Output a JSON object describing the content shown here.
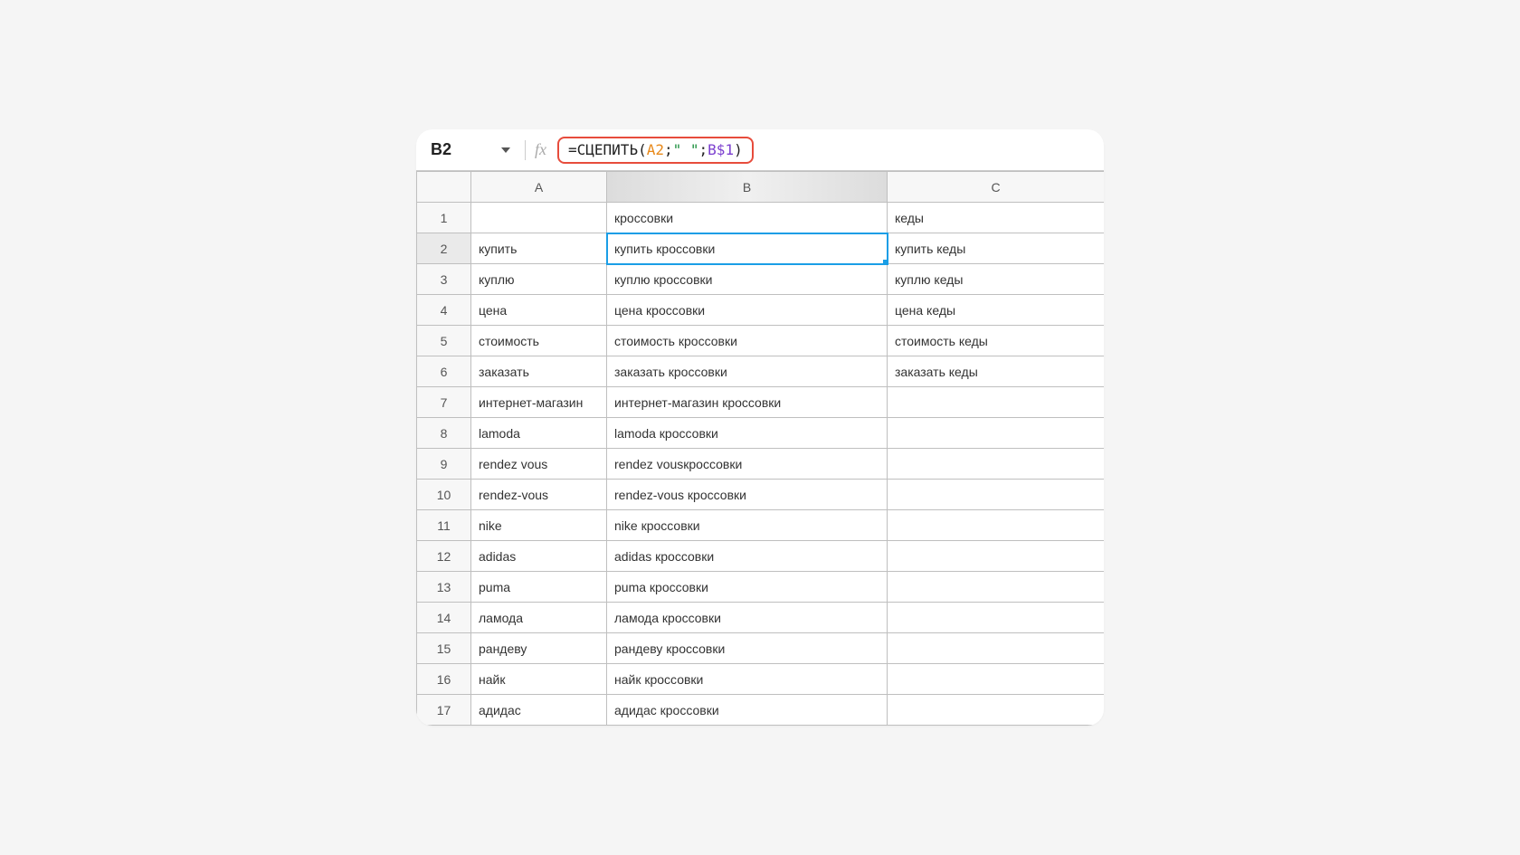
{
  "nameBox": "B2",
  "fx": "fx",
  "formula": {
    "eq": "=",
    "fn": "СЦЕПИТЬ",
    "open": "(",
    "ref1": "A2",
    "sep1": ";",
    "str": "\"  \"",
    "sep2": ";",
    "ref2": "B$1",
    "close": ")"
  },
  "columns": [
    "A",
    "B",
    "C"
  ],
  "rows": [
    {
      "n": "1",
      "A": "",
      "B": "кроссовки",
      "C": "кеды"
    },
    {
      "n": "2",
      "A": "купить",
      "B": "купить кроссовки",
      "C": "купить кеды"
    },
    {
      "n": "3",
      "A": "куплю",
      "B": "куплю кроссовки",
      "C": "куплю кеды"
    },
    {
      "n": "4",
      "A": "цена",
      "B": "цена кроссовки",
      "C": "цена кеды"
    },
    {
      "n": "5",
      "A": "стоимость",
      "B": "стоимость кроссовки",
      "C": "стоимость кеды"
    },
    {
      "n": "6",
      "A": "заказать",
      "B": "заказать кроссовки",
      "C": "заказать кеды"
    },
    {
      "n": "7",
      "A": "интернет-магазин",
      "B": "интернет-магазин кроссовки",
      "C": ""
    },
    {
      "n": "8",
      "A": "lamoda",
      "B": "lamoda кроссовки",
      "C": ""
    },
    {
      "n": "9",
      "A": "rendez vous",
      "B": "rendez vousкроссовки",
      "C": ""
    },
    {
      "n": "10",
      "A": "rendez-vous",
      "B": "rendez-vous кроссовки",
      "C": ""
    },
    {
      "n": "11",
      "A": "nike",
      "B": "nike кроссовки",
      "C": ""
    },
    {
      "n": "12",
      "A": "adidas",
      "B": "adidas кроссовки",
      "C": ""
    },
    {
      "n": "13",
      "A": "puma",
      "B": "puma кроссовки",
      "C": ""
    },
    {
      "n": "14",
      "A": "ламода",
      "B": "ламода кроссовки",
      "C": ""
    },
    {
      "n": "15",
      "A": "рандеву",
      "B": "рандеву кроссовки",
      "C": ""
    },
    {
      "n": "16",
      "A": "найк",
      "B": "найк кроссовки",
      "C": ""
    },
    {
      "n": "17",
      "A": "адидас",
      "B": "адидас кроссовки",
      "C": ""
    }
  ],
  "selectedCell": {
    "row": "2",
    "col": "B"
  }
}
